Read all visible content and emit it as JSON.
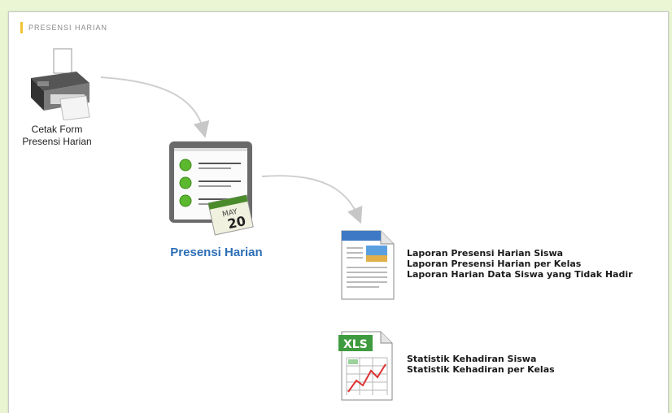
{
  "panel": {
    "title": "PRESENSI HARIAN"
  },
  "flow": {
    "print_form": {
      "label_line1": "Cetak Form",
      "label_line2": "Presensi Harian",
      "icon": "printer-icon"
    },
    "daily_attendance": {
      "label": "Presensi Harian",
      "icon": "attendance-checklist-icon",
      "calendar_month": "MAY",
      "calendar_day": "20"
    },
    "reports": {
      "icon": "report-document-icon",
      "links": [
        "Laporan Presensi Harian Siswa",
        "Laporan Presensi Harian per Kelas",
        "Laporan Harian Data Siswa yang Tidak Hadir"
      ]
    },
    "statistics": {
      "icon": "xls-spreadsheet-icon",
      "badge": "XLS",
      "links": [
        "Statistik Kehadiran Siswa",
        "Statistik Kehadiran per Kelas"
      ]
    }
  },
  "colors": {
    "accent": "#f1c232",
    "link_blue": "#2c6fb7",
    "page_bg": "#e8f5d0"
  }
}
